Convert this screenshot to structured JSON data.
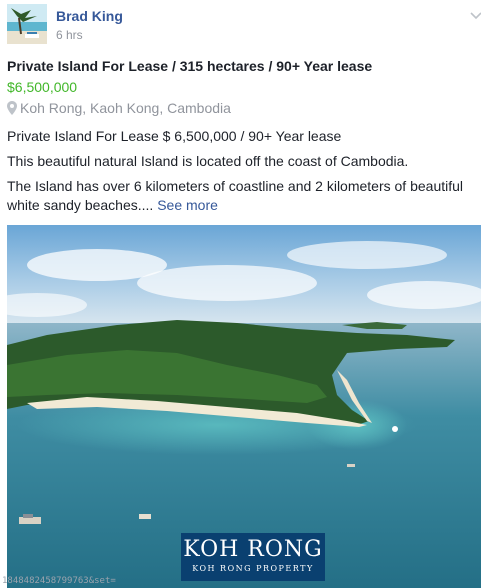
{
  "post": {
    "author": "Brad King",
    "time": "6 hrs",
    "title": "Private Island For Lease / 315 hectares / 90+ Year lease",
    "price": "$6,500,000",
    "location": "Koh Rong, Kaoh Kong, Cambodia",
    "description_lines": [
      "Private Island For Lease $ 6,500,000 / 90+ Year lease",
      "This beautiful natural Island is located off the coast of Cambodia.",
      "The Island has over 6 kilometers of coastline and 2 kilometers of beautiful white sandy beaches...."
    ],
    "see_more": "See more"
  },
  "photo": {
    "logo_main": "KOH RONG",
    "logo_sub": "KOH RONG PROPERTY"
  },
  "url_fragment": "1848482458799763&set=",
  "colors": {
    "author": "#365899",
    "price": "#42b72a",
    "meta": "#90949c",
    "text": "#1d2129"
  },
  "icons": [
    "chevron-down-icon",
    "location-pin-icon"
  ]
}
